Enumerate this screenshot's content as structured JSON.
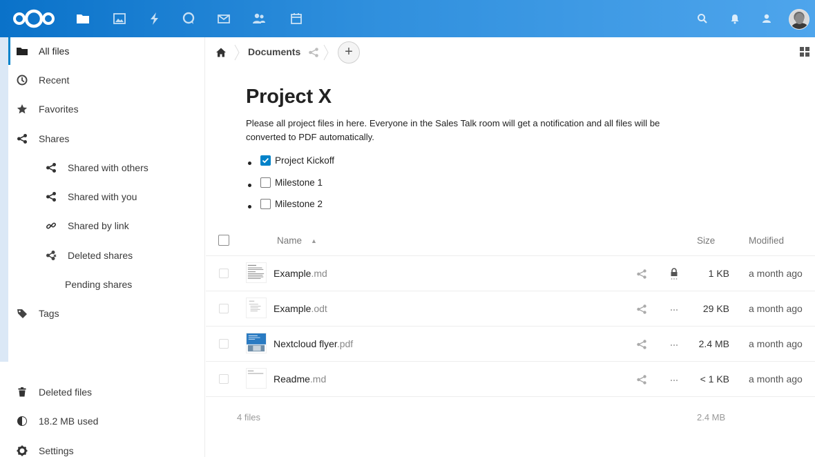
{
  "colors": {
    "accent": "#0082c9",
    "topbar": "#2f8fdd"
  },
  "topbar": {
    "apps": [
      "files-icon",
      "photos-icon",
      "activity-icon",
      "talk-icon",
      "mail-icon",
      "contacts-icon",
      "calendar-icon"
    ],
    "right": [
      "search-icon",
      "notifications-icon",
      "contacts-menu-icon",
      "avatar"
    ]
  },
  "sidebar": {
    "items": [
      {
        "label": "All files",
        "icon": "folder-icon"
      },
      {
        "label": "Recent",
        "icon": "clock-icon"
      },
      {
        "label": "Favorites",
        "icon": "star-icon"
      },
      {
        "label": "Shares",
        "icon": "share-icon"
      },
      {
        "label": "Shared with others",
        "icon": "share-icon"
      },
      {
        "label": "Shared with you",
        "icon": "share-icon"
      },
      {
        "label": "Shared by link",
        "icon": "link-icon"
      },
      {
        "label": "Deleted shares",
        "icon": "deleted-share-icon"
      },
      {
        "label": "Pending shares",
        "icon": ""
      },
      {
        "label": "Tags",
        "icon": "tag-icon"
      }
    ],
    "footer": [
      {
        "label": "Deleted files",
        "icon": "trash-icon"
      },
      {
        "label": "18.2 MB used",
        "icon": "quota-icon"
      },
      {
        "label": "Settings",
        "icon": "gear-icon"
      }
    ]
  },
  "breadcrumb": {
    "current": "Documents",
    "add_label": "+"
  },
  "readme": {
    "title": "Project X",
    "text": "Please all project files in here. Everyone in the Sales Talk room will get a notification and all files will be converted to PDF automatically.",
    "todos": [
      {
        "label": "Project Kickoff",
        "checked": true
      },
      {
        "label": "Milestone 1",
        "checked": false
      },
      {
        "label": "Milestone 2",
        "checked": false
      }
    ]
  },
  "table": {
    "col_name": "Name",
    "col_size": "Size",
    "col_modified": "Modified",
    "files": [
      {
        "base": "Example",
        "ext": ".md",
        "size": "1 KB",
        "modified": "a month ago",
        "locked": true
      },
      {
        "base": "Example",
        "ext": ".odt",
        "size": "29 KB",
        "modified": "a month ago",
        "locked": false
      },
      {
        "base": "Nextcloud flyer",
        "ext": ".pdf",
        "size": "2.4 MB",
        "modified": "a month ago",
        "locked": false
      },
      {
        "base": "Readme",
        "ext": ".md",
        "size": "< 1 KB",
        "modified": "a month ago",
        "locked": false
      }
    ],
    "summary_files": "4 files",
    "summary_size": "2.4 MB"
  }
}
